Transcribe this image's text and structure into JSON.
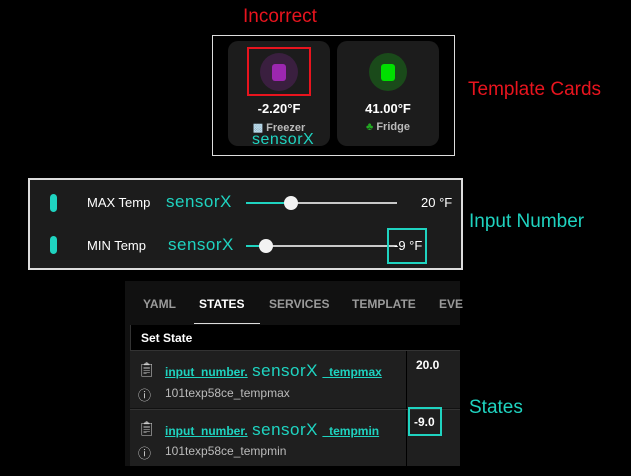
{
  "annotations": {
    "incorrect": "Incorrect",
    "template_cards": "Template Cards",
    "input_number": "Input Number",
    "states": "States",
    "sensor_placeholder": "sensorX"
  },
  "template_cards": [
    {
      "value": "-2.20°F",
      "name": "Freezer",
      "icon": "fridge-icon",
      "badge_icon": "ice-cube-icon",
      "color": "#9c27b0"
    },
    {
      "value": "41.00°F",
      "name": "Fridge",
      "icon": "fridge-icon",
      "badge_icon": "broccoli-icon",
      "color": "#00e000"
    }
  ],
  "input_numbers": [
    {
      "label": "MAX Temp",
      "value": "20 °F",
      "slider_fraction": 0.3
    },
    {
      "label": "MIN Temp",
      "value": "-9 °F",
      "slider_fraction": 0.13
    }
  ],
  "dev_tools": {
    "tabs": [
      "YAML",
      "STATES",
      "SERVICES",
      "TEMPLATE",
      "EVE"
    ],
    "active_tab": "STATES",
    "header": "Set State",
    "rows": [
      {
        "entity_prefix": "input_number.",
        "entity_suffix": "_tempmax",
        "friendly": "101texp58ce_tempmax",
        "state": "20.0"
      },
      {
        "entity_prefix": "input_number.",
        "entity_suffix": "_tempmin",
        "friendly": "101texp58ce_tempmin",
        "state": "-9.0"
      }
    ]
  }
}
